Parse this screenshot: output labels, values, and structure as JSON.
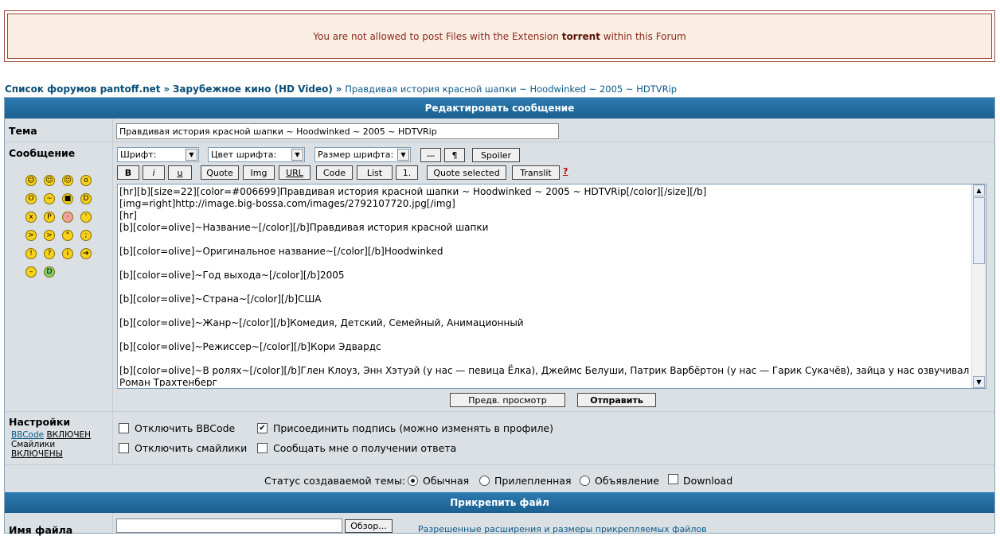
{
  "alert": {
    "prefix": "You are not allowed to post Files with the Extension",
    "extension": "torrent",
    "suffix": "within this Forum"
  },
  "breadcrumb": {
    "forum_index": "Список форумов pantoff.net",
    "separator": "»",
    "section": "Зарубежное кино (HD Video)",
    "topic": "Правдивая история красной шапки ~ Hoodwinked ~ 2005 ~ HDTVRip"
  },
  "editor": {
    "header": "Редактировать сообщение",
    "subject_label": "Тема",
    "subject_value": "Правдивая история красной шапки ~ Hoodwinked ~ 2005 ~ HDTVRip",
    "message_label": "Сообщение",
    "toolbar": {
      "font_select": "Шрифт:",
      "color_select": "Цвет шрифта:",
      "size_select": "Размер шрифта:",
      "hr_button": "—",
      "para_button": "¶",
      "spoiler_button": "Spoiler",
      "bold": "B",
      "italic": "i",
      "underline": "u",
      "quote": "Quote",
      "img": "Img",
      "url": "URL",
      "code": "Code",
      "list": "List",
      "list_num": "1.",
      "quote_selected": "Quote selected",
      "translit": "Translit",
      "help": "?"
    },
    "message_text": "[hr][b][size=22][color=#006699]Правдивая история красной шапки ~ Hoodwinked ~ 2005 ~ HDTVRip[/color][/size][/b]\n[img=right]http://image.big-bossa.com/images/2792107720.jpg[/img]\n[hr]\n[b][color=olive]~Название~[/color][/b]Правдивая история красной шапки\n\n[b][color=olive]~Оригинальное название~[/color][/b]Hoodwinked\n\n[b][color=olive]~Год выхода~[/color][/b]2005\n\n[b][color=olive]~Страна~[/color][/b]США\n\n[b][color=olive]~Жанр~[/color][/b]Комедия, Детский, Семейный, Анимационный\n\n[b][color=olive]~Режиссер~[/color][/b]Кори Эдвардс\n\n[b][color=olive]~В ролях~[/color][/b]Глен Клоуз, Энн Хэтуэй (у нас — певица Ёлка), Джеймс Белуши, Патрик Варбёртон (у нас — Гарик Сукачёв), зайца у нас озвучивал Роман Трахтенберг",
    "preview_button": "Предв. просмотр",
    "submit_button": "Отправить"
  },
  "settings": {
    "label": "Настройки",
    "bbcode_link": "BBCode",
    "bbcode_state": "ВКЛЮЧЕН",
    "smilies_label": "Смайлики",
    "smilies_state": "ВКЛЮЧЕНЫ",
    "disable_bbcode": "Отключить BBCode",
    "attach_signature": "Присоединить подпись (можно изменять в профиле)",
    "disable_smilies": "Отключить смайлики",
    "notify_reply": "Сообщать мне о получении ответа"
  },
  "topic_status": {
    "label": "Статус создаваемой темы:",
    "normal": "Обычная",
    "sticky": "Прилепленная",
    "announcement": "Объявление",
    "download": "Download"
  },
  "attach": {
    "header": "Прикрепить файл",
    "filename_label": "Имя файла",
    "browse_button": "Обзор...",
    "extensions_link": "Разрешенные расширения и размеры прикрепляемых файлов"
  },
  "smilies": [
    "very-happy-icon",
    "smile-icon",
    "sad-icon",
    "surprised-icon",
    "shocked-icon",
    "confused-icon",
    "cool-icon",
    "laughing-icon",
    "mad-icon",
    "razz-icon",
    "embarrassed-icon",
    "crying-icon",
    "evil-icon",
    "twisted-evil-icon",
    "rolling-eyes-icon",
    "wink-icon",
    "exclamation-icon",
    "question-icon",
    "idea-icon",
    "arrow-icon",
    "neutral-icon",
    "mr-green-icon"
  ],
  "colors": {
    "alert_bg": "#faeee3",
    "alert_border": "#a04a38",
    "header_bar": "#1b5f8f",
    "link": "#0b4f78",
    "panel_bg": "#dbe0e4"
  }
}
